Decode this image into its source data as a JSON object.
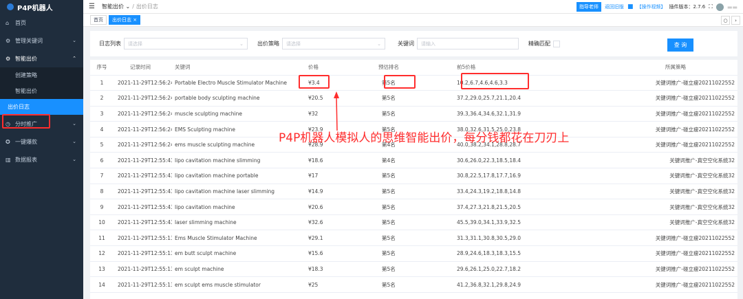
{
  "app": {
    "name": "P4P机器人"
  },
  "sidebar": {
    "items": [
      {
        "icon": "home-icon",
        "label": "首页"
      },
      {
        "icon": "key-icon",
        "label": "管理关键词"
      },
      {
        "icon": "smart-bid-icon",
        "label": "智能出价"
      },
      {
        "icon": "clock-icon",
        "label": "分时推广"
      },
      {
        "icon": "rocket-icon",
        "label": "一键爆款"
      },
      {
        "icon": "chart-icon",
        "label": "数据报表"
      }
    ],
    "sub_items": [
      "创建策略",
      "智能出价",
      "出价日志"
    ]
  },
  "header": {
    "breadcrumb_root": "智能出价",
    "breadcrumb_current": "出价日志",
    "mentor_button": "指导老师",
    "old_version_link": "返回旧版",
    "video_link": "【操作视频】",
    "plugin_version": "插件版本：2.7.6"
  },
  "tags": {
    "home": "首页",
    "active": "出价日志 ×"
  },
  "filters": {
    "log_list_label": "日志列表",
    "log_list_placeholder": "请选择",
    "strategy_label": "出价策略",
    "strategy_placeholder": "请选择",
    "keyword_label": "关键词",
    "keyword_placeholder": "请输入",
    "exact_match_label": "精确匹配",
    "query_button": "查 询"
  },
  "table": {
    "headers": [
      "序号",
      "记录时间",
      "关键词",
      "价格",
      "预估排名",
      "前5价格",
      "所属策略"
    ],
    "rows": [
      [
        "1",
        "2021-11-29T12:56:24",
        "Portable Electro Muscle Stimulator Machine",
        "¥3.4",
        "第5名",
        "10.2,6.7,4.6,4.6,3.3",
        "关键词推广-碰立瘦20211022552"
      ],
      [
        "2",
        "2021-11-29T12:56:24",
        "portable body sculpting machine",
        "¥20.5",
        "第5名",
        "37.2,29.0,25.7,21.1,20.4",
        "关键词推广-碰立瘦20211022552"
      ],
      [
        "3",
        "2021-11-29T12:56:24",
        "muscle sculpting machine",
        "¥32",
        "第5名",
        "39.3,36.4,34.6,32.1,31.9",
        "关键词推广-碰立瘦20211022552"
      ],
      [
        "4",
        "2021-11-29T12:56:24",
        "EMS Sculpting machine",
        "¥23.9",
        "第5名",
        "38.0,32.6,31.5,25.0,23.8",
        "关键词推广-碰立瘦20211022552"
      ],
      [
        "5",
        "2021-11-29T12:56:24",
        "ems muscle sculpting machine",
        "¥28.9",
        "第4名",
        "40.0,38.2,34.1,28.8,28.7",
        "关键词推广-碰立瘦20211022552"
      ],
      [
        "6",
        "2021-11-29T12:55:43",
        "lipo cavitation machine slimming",
        "¥18.6",
        "第4名",
        "30.6,26.0,22.3,18.5,18.4",
        "关键词推广-真空空化系统32"
      ],
      [
        "7",
        "2021-11-29T12:55:43",
        "lipo cavitation machine portable",
        "¥17",
        "第5名",
        "30.8,22.5,17.8,17.7,16.9",
        "关键词推广-真空空化系统32"
      ],
      [
        "8",
        "2021-11-29T12:55:43",
        "lipo cavitation machine laser slimming",
        "¥14.9",
        "第5名",
        "33.4,24.3,19.2,18.8,14.8",
        "关键词推广-真空空化系统32"
      ],
      [
        "9",
        "2021-11-29T12:55:43",
        "lipo cavitation machine",
        "¥20.6",
        "第5名",
        "37.4,27.3,21.8,21.5,20.5",
        "关键词推广-真空空化系统32"
      ],
      [
        "10",
        "2021-11-29T12:55:43",
        "laser slimming machine",
        "¥32.6",
        "第5名",
        "45.5,39.0,34.1,33.9,32.5",
        "关键词推广-真空空化系统32"
      ],
      [
        "11",
        "2021-11-29T12:55:13",
        "Ems Muscle Stimulator Machine",
        "¥29.1",
        "第5名",
        "31.3,31.1,30.8,30.5,29.0",
        "关键词推广-碰立瘦20211022552"
      ],
      [
        "12",
        "2021-11-29T12:55:13",
        "em butt sculpt machine",
        "¥15.6",
        "第5名",
        "28.9,24.6,18.3,18.3,15.5",
        "关键词推广-碰立瘦20211022552"
      ],
      [
        "13",
        "2021-11-29T12:55:13",
        "em sculpt machine",
        "¥18.3",
        "第5名",
        "29.6,26.1,25.0,22.7,18.2",
        "关键词推广-碰立瘦20211022552"
      ],
      [
        "14",
        "2021-11-29T12:55:13",
        "em sculpt ems muscle stimulator",
        "¥25",
        "第5名",
        "41.2,36.8,32.1,29.8,24.9",
        "关键词推广-碰立瘦20211022552"
      ]
    ]
  },
  "annotation": "P4P机器人模拟人的思维智能出价，每分钱都花在刀刃上",
  "colors": {
    "accent": "#1890ff",
    "sidebar_bg": "#1f2d3d",
    "highlight": "#ff2d2d"
  }
}
